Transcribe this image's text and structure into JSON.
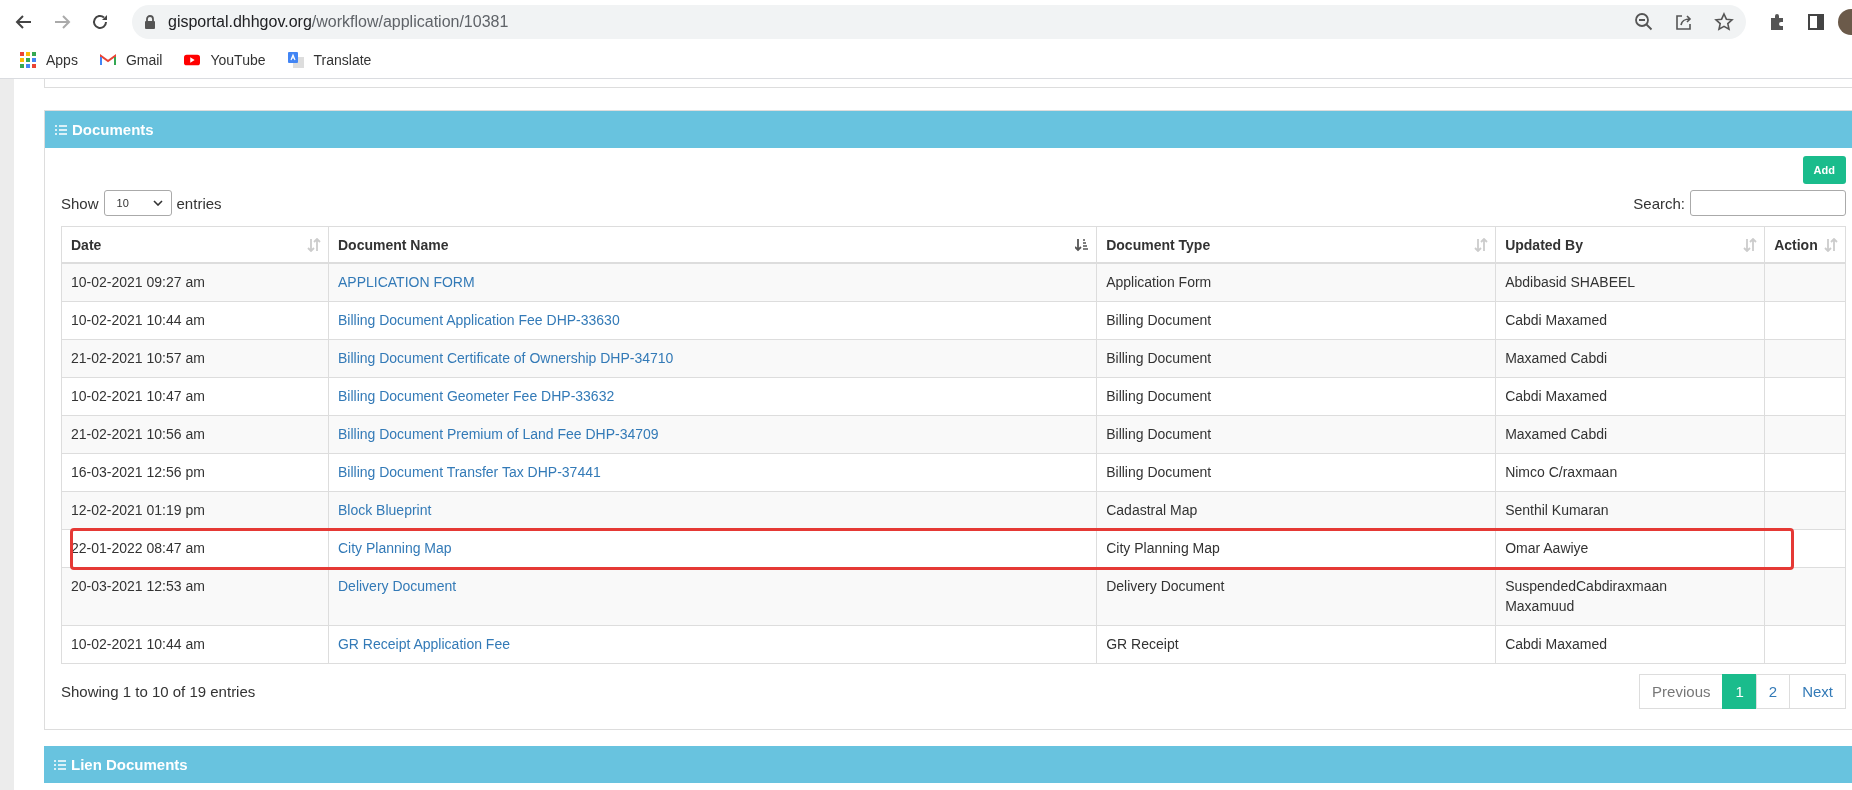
{
  "browser": {
    "url_host": "gisportal.dhhgov.org",
    "url_path": "/workflow/application/10381",
    "bookmarks": [
      {
        "label": "Apps",
        "kind": "apps"
      },
      {
        "label": "Gmail",
        "kind": "gmail"
      },
      {
        "label": "YouTube",
        "kind": "youtube"
      },
      {
        "label": "Translate",
        "kind": "translate"
      }
    ]
  },
  "documents_panel": {
    "title": "Documents",
    "add_button": "Add",
    "length_prefix": "Show",
    "length_value": "10",
    "length_suffix": "entries",
    "search_label": "Search:",
    "columns": [
      {
        "label": "Date",
        "sorted": false
      },
      {
        "label": "Document Name",
        "sorted": true
      },
      {
        "label": "Document Type",
        "sorted": false
      },
      {
        "label": "Updated By",
        "sorted": false
      },
      {
        "label": "Action",
        "sorted": false
      }
    ],
    "rows": [
      {
        "date": "10-02-2021 09:27 am",
        "name": "APPLICATION FORM",
        "type": "Application Form",
        "updated_by": "Abdibasid SHABEEL",
        "highlighted": false
      },
      {
        "date": "10-02-2021 10:44 am",
        "name": "Billing Document Application Fee DHP-33630",
        "type": "Billing Document",
        "updated_by": "Cabdi Maxamed",
        "highlighted": false
      },
      {
        "date": "21-02-2021 10:57 am",
        "name": "Billing Document Certificate of Ownership DHP-34710",
        "type": "Billing Document",
        "updated_by": "Maxamed Cabdi",
        "highlighted": false
      },
      {
        "date": "10-02-2021 10:47 am",
        "name": "Billing Document Geometer Fee DHP-33632",
        "type": "Billing Document",
        "updated_by": "Cabdi Maxamed",
        "highlighted": false
      },
      {
        "date": "21-02-2021 10:56 am",
        "name": "Billing Document Premium of Land Fee DHP-34709",
        "type": "Billing Document",
        "updated_by": "Maxamed Cabdi",
        "highlighted": false
      },
      {
        "date": "16-03-2021 12:56 pm",
        "name": "Billing Document Transfer Tax DHP-37441",
        "type": "Billing Document",
        "updated_by": "Nimco C/raxmaan",
        "highlighted": false
      },
      {
        "date": "12-02-2021 01:19 pm",
        "name": "Block Blueprint",
        "type": "Cadastral Map",
        "updated_by": "Senthil Kumaran",
        "highlighted": false
      },
      {
        "date": "22-01-2022 08:47 am",
        "name": "City Planning Map",
        "type": "City Planning Map",
        "updated_by": "Omar Aawiye",
        "highlighted": true
      },
      {
        "date": "20-03-2021 12:53 am",
        "name": "Delivery Document",
        "type": "Delivery Document",
        "updated_by": "SuspendedCabdiraxmaan Maxamuud",
        "highlighted": false
      },
      {
        "date": "10-02-2021 10:44 am",
        "name": "GR Receipt Application Fee",
        "type": "GR Receipt",
        "updated_by": "Cabdi Maxamed",
        "highlighted": false
      }
    ],
    "info": "Showing 1 to 10 of 19 entries",
    "pagination": [
      {
        "label": "Previous",
        "disabled": true,
        "selected": false
      },
      {
        "label": "1",
        "disabled": false,
        "selected": true
      },
      {
        "label": "2",
        "disabled": false,
        "selected": false
      },
      {
        "label": "Next",
        "disabled": false,
        "selected": false
      }
    ]
  },
  "lien_panel": {
    "title": "Lien Documents"
  }
}
